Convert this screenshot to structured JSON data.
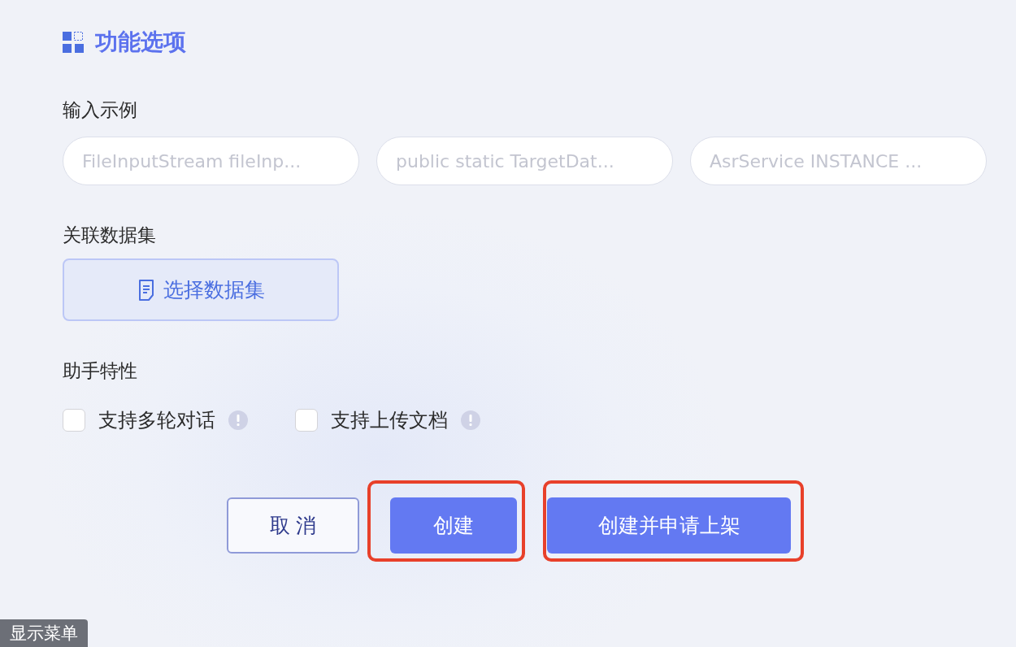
{
  "section_title": "功能选项",
  "example_input": {
    "label": "输入示例",
    "chips": [
      {
        "text": "FileInputStream fileInp..."
      },
      {
        "text": "public static TargetDat..."
      },
      {
        "text": "AsrService INSTANCE ..."
      }
    ]
  },
  "dataset": {
    "label": "关联数据集",
    "button": "选择数据集"
  },
  "features": {
    "label": "助手特性",
    "options": [
      {
        "label": "支持多轮对话",
        "checked": false
      },
      {
        "label": "支持上传文档",
        "checked": false
      }
    ]
  },
  "buttons": [
    {
      "label": "取 消",
      "kind": "secondary",
      "highlighted": false
    },
    {
      "label": "创建",
      "kind": "primary",
      "highlighted": true
    },
    {
      "label": "创建并申请上架",
      "kind": "primary",
      "highlighted": true
    }
  ],
  "menu_toggle": "显示菜单"
}
